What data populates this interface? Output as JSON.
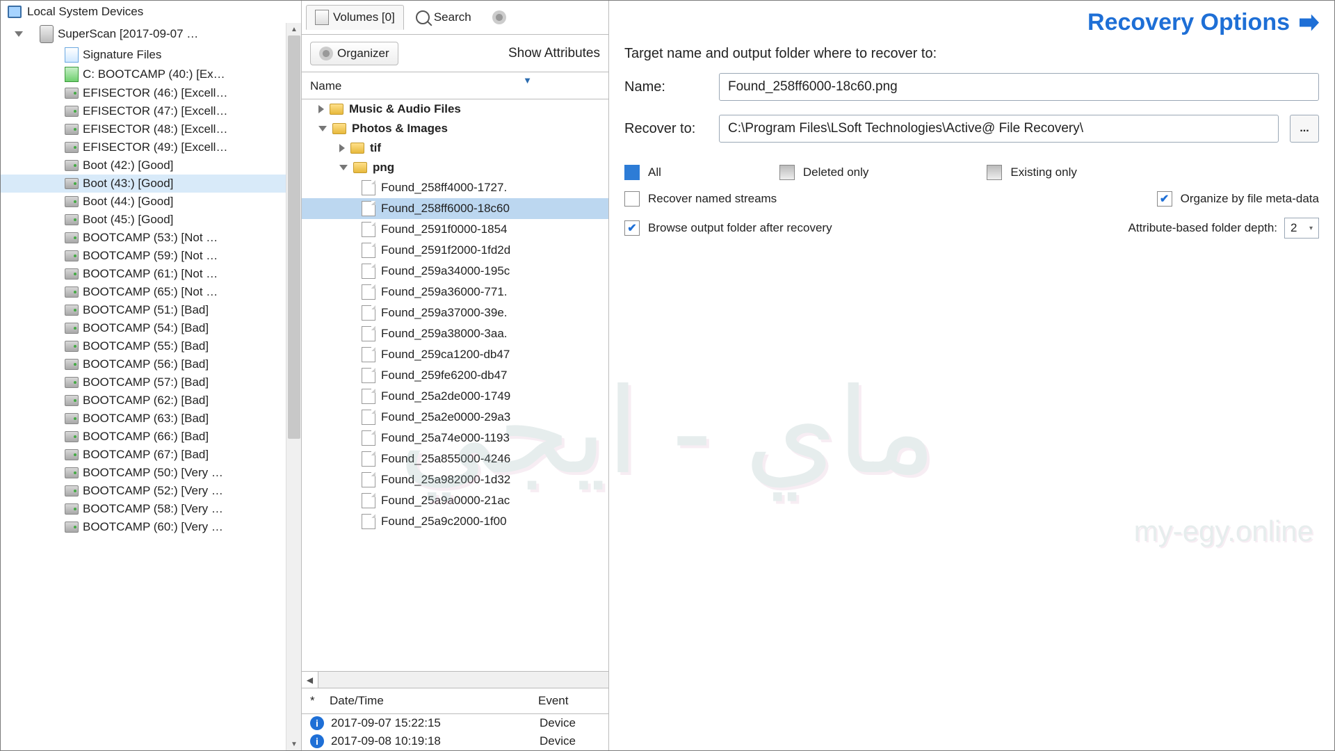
{
  "sidebar": {
    "title": "Local System Devices",
    "root": "SuperScan [2017-09-07 …",
    "items": [
      {
        "label": "Signature Files",
        "icon": "sig"
      },
      {
        "label": "C: BOOTCAMP (40:) [Ex…",
        "icon": "cgreen"
      },
      {
        "label": "EFISECTOR (46:) [Excell…",
        "icon": "drive"
      },
      {
        "label": "EFISECTOR (47:) [Excell…",
        "icon": "drive"
      },
      {
        "label": "EFISECTOR (48:) [Excell…",
        "icon": "drive"
      },
      {
        "label": "EFISECTOR (49:) [Excell…",
        "icon": "drive"
      },
      {
        "label": "Boot (42:) [Good]",
        "icon": "drive"
      },
      {
        "label": "Boot (43:) [Good]",
        "icon": "drive",
        "sel": true
      },
      {
        "label": "Boot (44:) [Good]",
        "icon": "drive"
      },
      {
        "label": "Boot (45:) [Good]",
        "icon": "drive"
      },
      {
        "label": "BOOTCAMP (53:) [Not …",
        "icon": "drive"
      },
      {
        "label": "BOOTCAMP (59:) [Not …",
        "icon": "drive"
      },
      {
        "label": "BOOTCAMP (61:) [Not …",
        "icon": "drive"
      },
      {
        "label": "BOOTCAMP (65:) [Not …",
        "icon": "drive"
      },
      {
        "label": "BOOTCAMP (51:) [Bad]",
        "icon": "drive"
      },
      {
        "label": "BOOTCAMP (54:) [Bad]",
        "icon": "drive"
      },
      {
        "label": "BOOTCAMP (55:) [Bad]",
        "icon": "drive"
      },
      {
        "label": "BOOTCAMP (56:) [Bad]",
        "icon": "drive"
      },
      {
        "label": "BOOTCAMP (57:) [Bad]",
        "icon": "drive"
      },
      {
        "label": "BOOTCAMP (62:) [Bad]",
        "icon": "drive"
      },
      {
        "label": "BOOTCAMP (63:) [Bad]",
        "icon": "drive"
      },
      {
        "label": "BOOTCAMP (66:) [Bad]",
        "icon": "drive"
      },
      {
        "label": "BOOTCAMP (67:) [Bad]",
        "icon": "drive"
      },
      {
        "label": "BOOTCAMP (50:) [Very …",
        "icon": "drive"
      },
      {
        "label": "BOOTCAMP (52:) [Very …",
        "icon": "drive"
      },
      {
        "label": "BOOTCAMP (58:) [Very …",
        "icon": "drive"
      },
      {
        "label": "BOOTCAMP (60:) [Very …",
        "icon": "drive"
      }
    ]
  },
  "tabs": {
    "volumes": "Volumes [0]",
    "search": "Search"
  },
  "toolbar": {
    "organizer": "Organizer",
    "show_attributes": "Show Attributes"
  },
  "list_header": "Name",
  "folders": {
    "music": "Music & Audio Files",
    "photos": "Photos & Images",
    "tif": "tif",
    "png": "png"
  },
  "files": [
    "Found_258ff4000-1727.",
    "Found_258ff6000-18c60",
    "Found_2591f0000-1854",
    "Found_2591f2000-1fd2d",
    "Found_259a34000-195c",
    "Found_259a36000-771.",
    "Found_259a37000-39e.",
    "Found_259a38000-3aa.",
    "Found_259ca1200-db47",
    "Found_259fe6200-db47",
    "Found_25a2de000-1749",
    "Found_25a2e0000-29a3",
    "Found_25a74e000-1193",
    "Found_25a855000-4246",
    "Found_25a982000-1d32",
    "Found_25a9a0000-21ac",
    "Found_25a9c2000-1f00"
  ],
  "file_selected_index": 1,
  "events": {
    "head_star": "*",
    "head_dt": "Date/Time",
    "head_ev": "Event",
    "rows": [
      {
        "dt": "2017-09-07 15:22:15",
        "ev": "Device"
      },
      {
        "dt": "2017-09-08 10:19:18",
        "ev": "Device"
      }
    ]
  },
  "dialog": {
    "title": "Recovery Options",
    "subtitle": "Target name and output folder where to recover to:",
    "name_label": "Name:",
    "name_value": "Found_258ff6000-18c60.png",
    "recover_label": "Recover to:",
    "recover_value": "C:\\Program Files\\LSoft Technologies\\Active@ File Recovery\\",
    "browse": "...",
    "filter": {
      "all": "All",
      "deleted": "Deleted only",
      "existing": "Existing only"
    },
    "chk_named": "Recover named streams",
    "chk_organize": "Organize by file meta-data",
    "chk_browse": "Browse output folder after recovery",
    "depth_label": "Attribute-based folder depth:",
    "depth_value": "2"
  },
  "watermark": {
    "text": "ماي - ايجي",
    "url": "my-egy.online"
  }
}
